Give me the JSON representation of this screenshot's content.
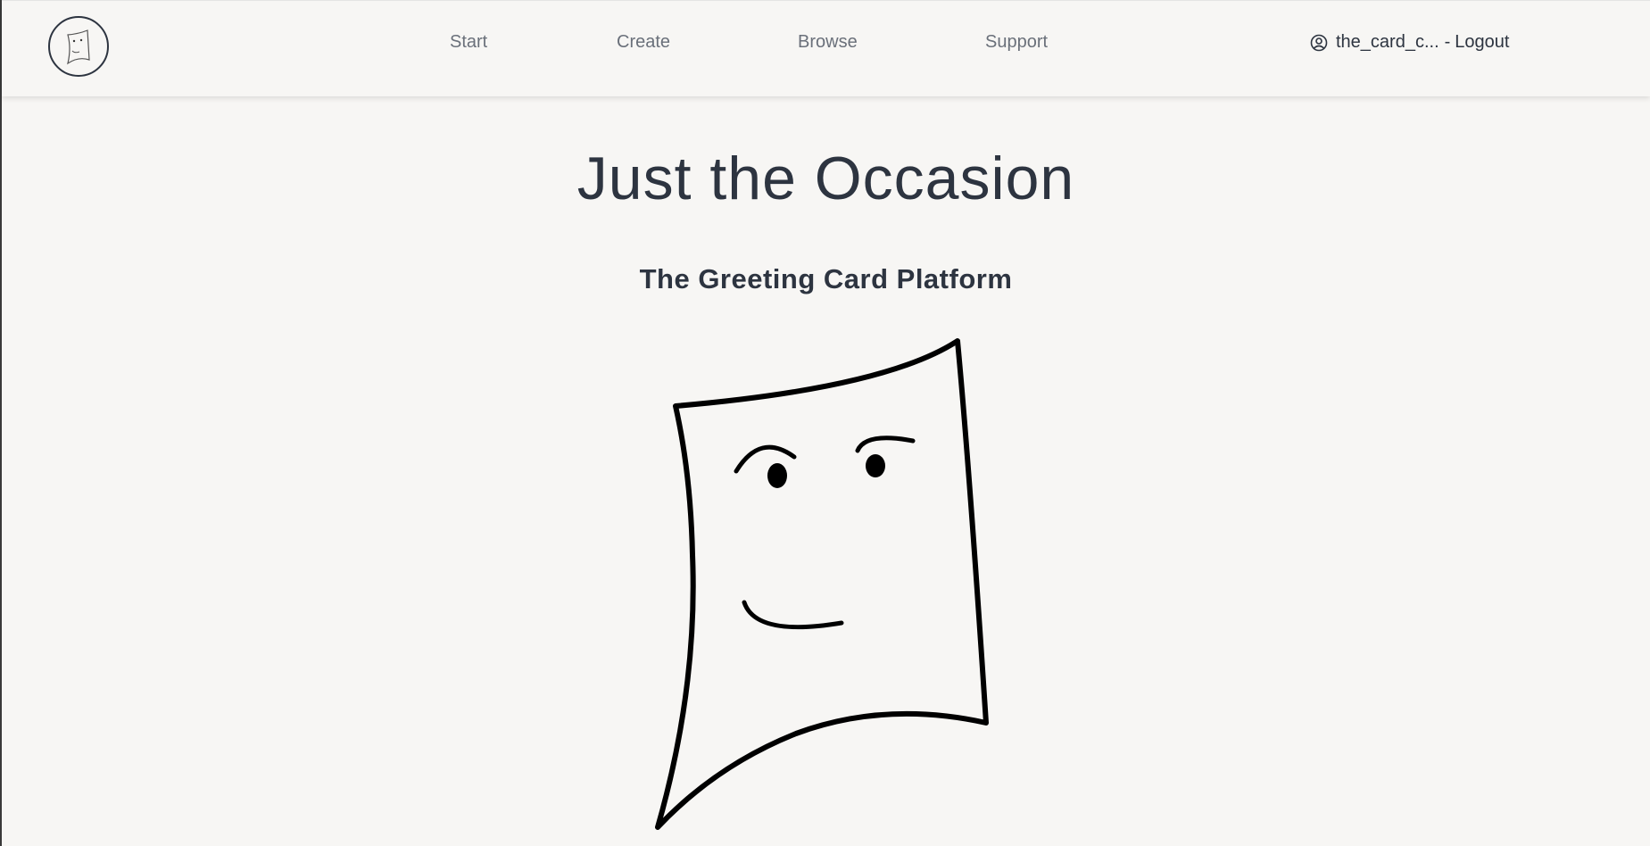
{
  "nav": {
    "logo_icon": "card-face-logo-icon",
    "links": [
      {
        "label": "Start"
      },
      {
        "label": "Create"
      },
      {
        "label": "Browse"
      },
      {
        "label": "Support"
      }
    ],
    "user": {
      "icon": "user-circle-icon",
      "username": "the_card_c...",
      "separator": "-",
      "logout_label": "Logout"
    }
  },
  "hero": {
    "title": "Just the Occasion",
    "subtitle": "The Greeting Card Platform",
    "illustration_icon": "smiling-card-illustration"
  },
  "colors": {
    "background": "#f7f6f4",
    "text": "#2d3440",
    "nav_link": "#6a707a"
  }
}
